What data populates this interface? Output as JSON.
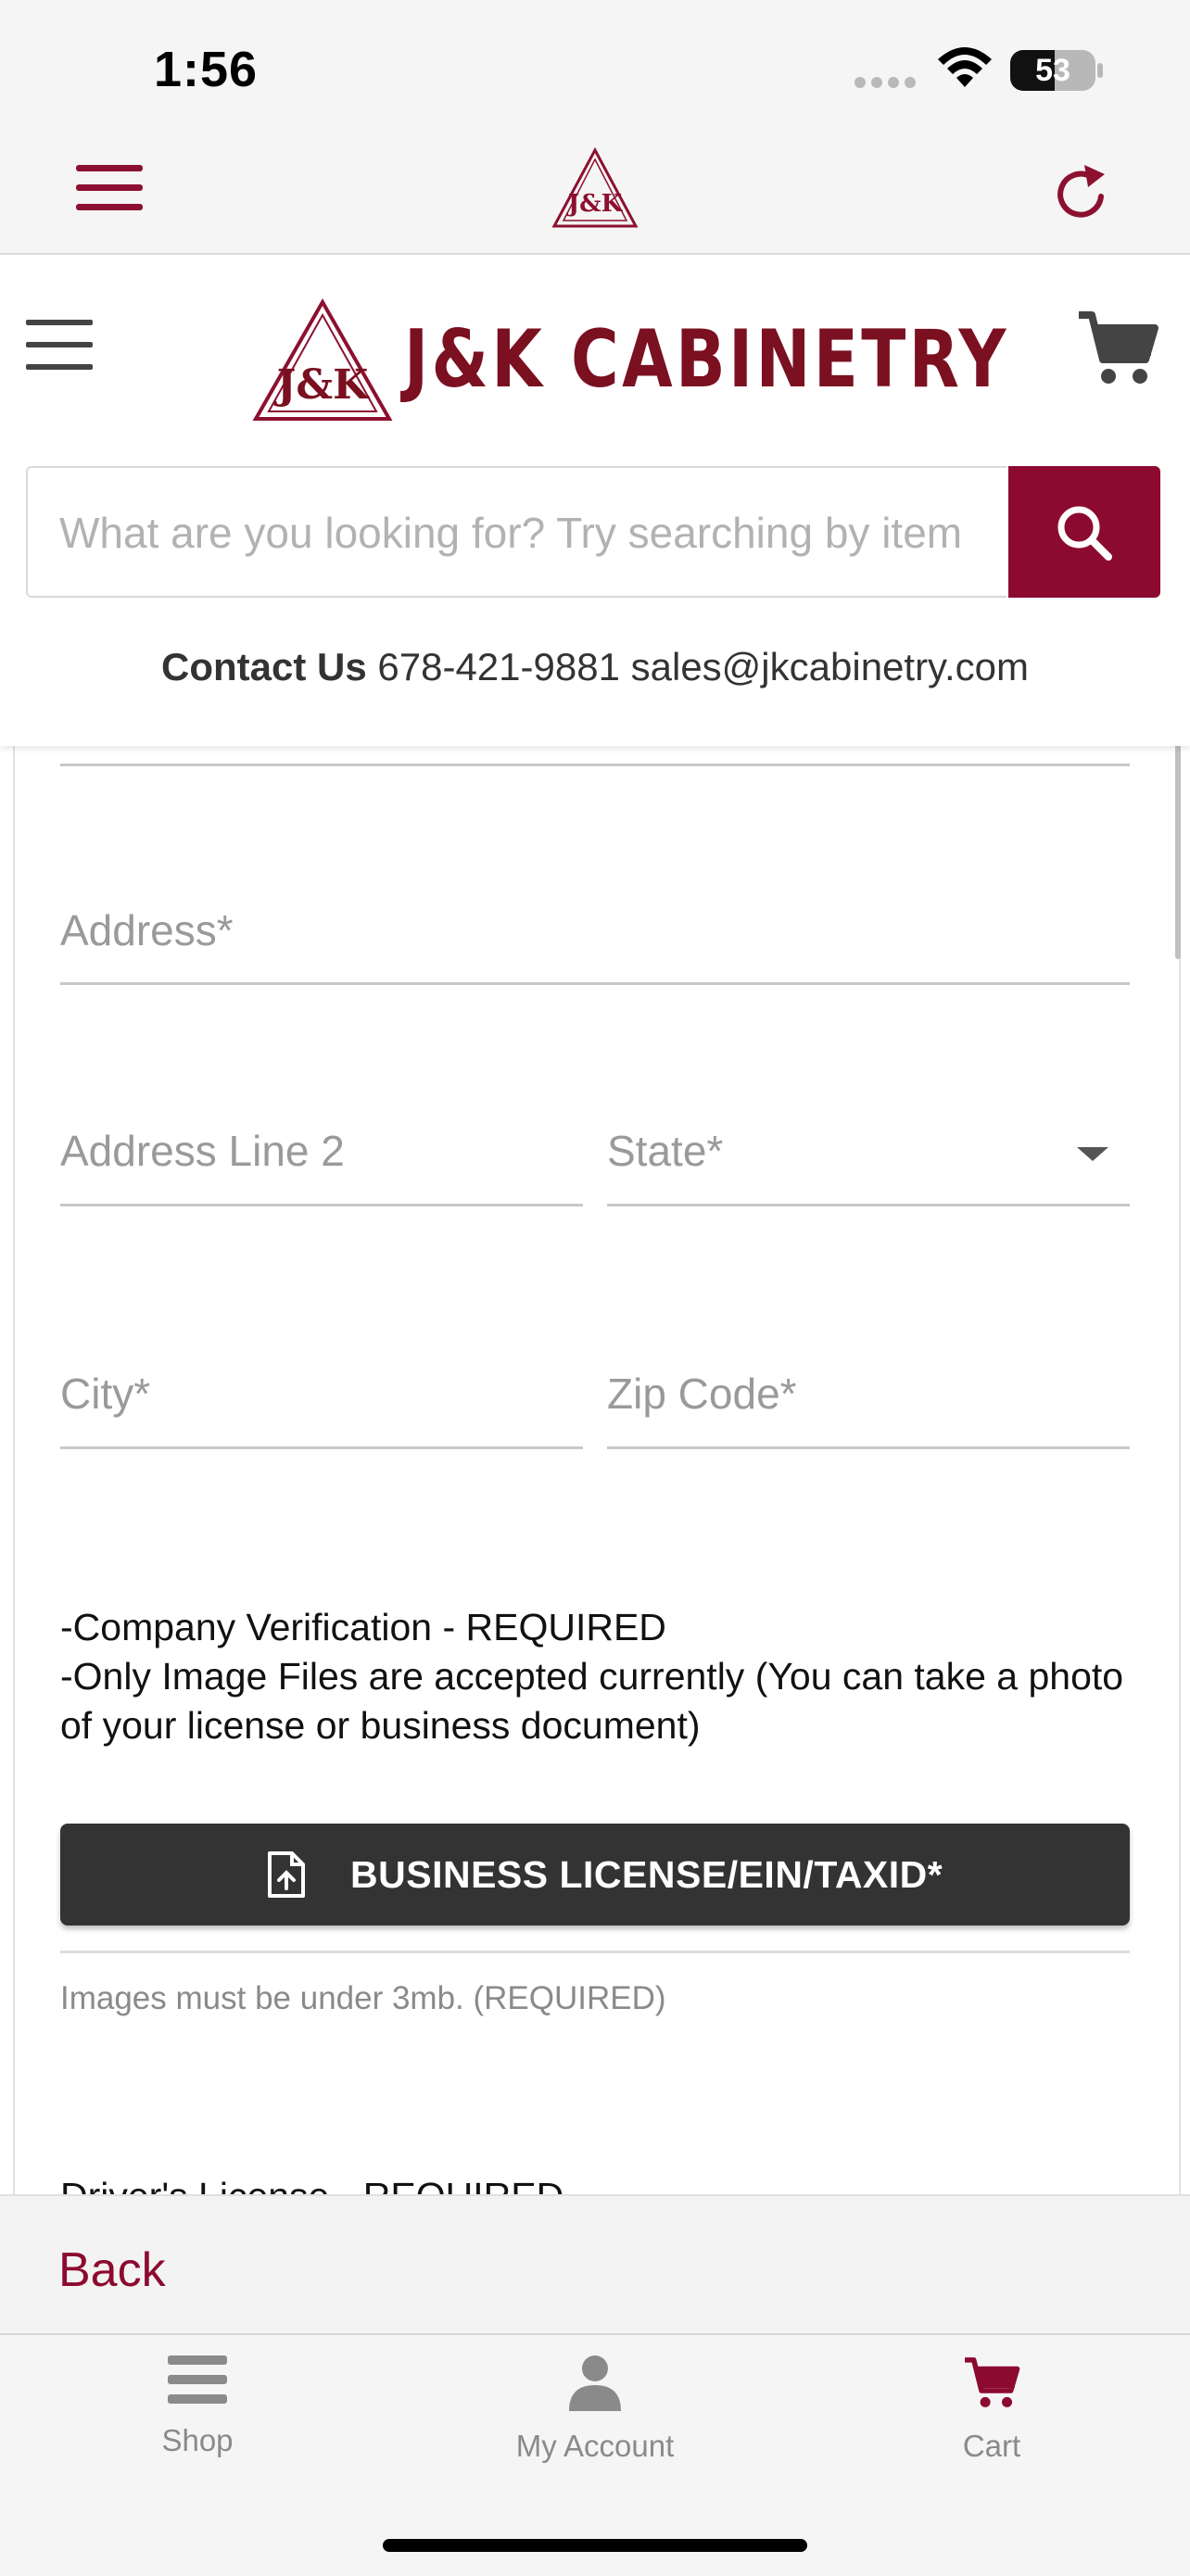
{
  "status_bar": {
    "time": "1:56",
    "battery": "53",
    "wifi_icon": "wifi-icon",
    "signal_icon": "cellular-signal-icon"
  },
  "app_bar": {
    "menu_icon": "hamburger-menu-icon",
    "logo_text": "J&K",
    "refresh_icon": "refresh-icon"
  },
  "site_header": {
    "menu_icon": "hamburger-menu-icon",
    "logo_mark": "J&K",
    "brand": "J&K CABINETRY",
    "cart_icon": "shopping-cart-icon",
    "search": {
      "placeholder": "What are you looking for? Try searching by item",
      "value": "",
      "button_icon": "search-icon"
    },
    "contact": {
      "label": "Contact Us",
      "phone": "678-421-9881",
      "email": "sales@jkcabinetry.com"
    }
  },
  "form": {
    "fields": {
      "address": "Address*",
      "address_line_2": "Address Line 2",
      "state": "State*",
      "city": "City*",
      "zip_code": "Zip Code*"
    },
    "notice": {
      "line1": "-Company Verification - REQUIRED",
      "line2": "-Only Image Files are accepted currently (You can take a photo of your license or business document)"
    },
    "upload_button": "BUSINESS LICENSE/EIN/TAXID*",
    "upload_icon": "file-upload-icon",
    "hint": "Images must be under 3mb. (REQUIRED)",
    "next_section": "Driver's License - REQUIRED"
  },
  "footer": {
    "back": "Back",
    "tabs": [
      {
        "label": "Shop",
        "icon": "menu-bars-icon",
        "active": false
      },
      {
        "label": "My Account",
        "icon": "user-icon",
        "active": false
      },
      {
        "label": "Cart",
        "icon": "shopping-cart-icon",
        "active": true
      }
    ]
  },
  "colors": {
    "brand": "#8c0a30",
    "dark_button": "#333333",
    "muted_text": "#9a9a9a"
  }
}
